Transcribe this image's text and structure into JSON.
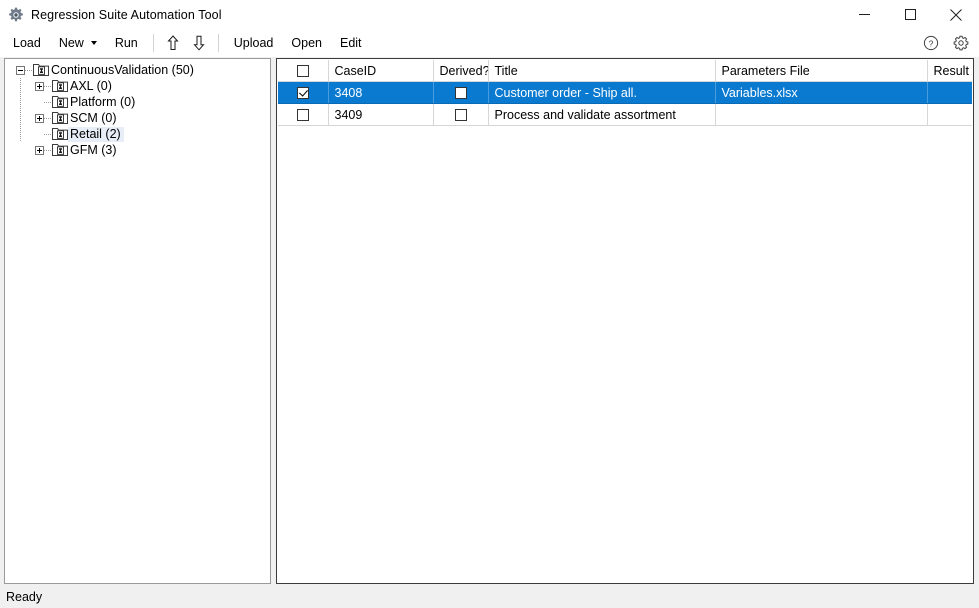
{
  "window": {
    "title": "Regression Suite Automation Tool",
    "icon": "gear-icon",
    "minimize_label": "Minimize",
    "maximize_label": "Maximize",
    "close_label": "Close"
  },
  "toolbar": {
    "load_label": "Load",
    "new_label": "New",
    "run_label": "Run",
    "move_up_label": "Move Up",
    "move_down_label": "Move Down",
    "upload_label": "Upload",
    "open_label": "Open",
    "edit_label": "Edit",
    "help_label": "Help",
    "settings_label": "Settings"
  },
  "tree": {
    "root": {
      "label": "ContinuousValidation (50)",
      "expander": "minus",
      "selected": false
    },
    "children": [
      {
        "label": "AXL (0)",
        "expander": "plus",
        "selected": false
      },
      {
        "label": "Platform (0)",
        "expander": "none",
        "selected": false
      },
      {
        "label": "SCM (0)",
        "expander": "plus",
        "selected": false
      },
      {
        "label": "Retail (2)",
        "expander": "none",
        "selected": true
      },
      {
        "label": "GFM (3)",
        "expander": "plus",
        "selected": false
      }
    ]
  },
  "grid": {
    "columns": [
      {
        "key": "select",
        "label": "",
        "type": "checkbox"
      },
      {
        "key": "caseid",
        "label": "CaseID"
      },
      {
        "key": "derived",
        "label": "Derived?",
        "type": "checkbox"
      },
      {
        "key": "title",
        "label": "Title"
      },
      {
        "key": "parameters_file",
        "label": "Parameters File"
      },
      {
        "key": "result",
        "label": "Result"
      }
    ],
    "header_select_all_checked": false,
    "rows": [
      {
        "selected": true,
        "checked": true,
        "caseid": "3408",
        "derived": false,
        "title": "Customer order - Ship all.",
        "parameters_file": "Variables.xlsx",
        "result": ""
      },
      {
        "selected": false,
        "checked": false,
        "caseid": "3409",
        "derived": false,
        "title": "Process and validate assortment",
        "parameters_file": "",
        "result": ""
      }
    ]
  },
  "statusbar": {
    "text": "Ready"
  },
  "colors": {
    "selection_blue": "#0a7ad0",
    "tree_selection": "#e8eef7",
    "window_bg": "#f0f0f0",
    "close_hover": "#e81123"
  }
}
